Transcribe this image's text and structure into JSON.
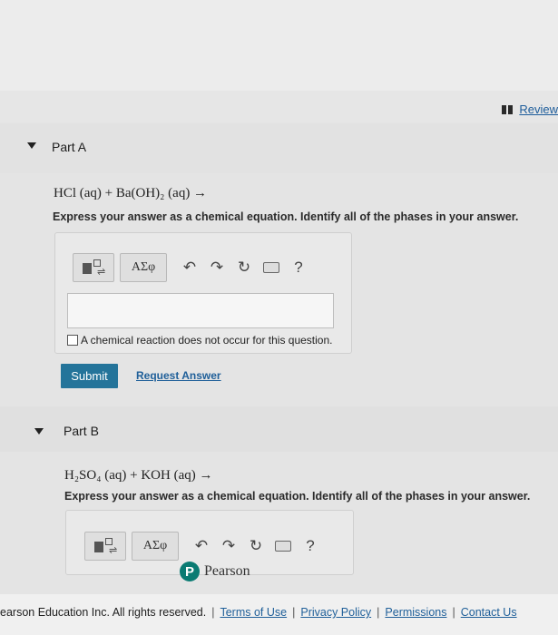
{
  "header": {
    "review_label": "Review"
  },
  "part_a": {
    "title": "Part A",
    "equation": "HCl (aq) + Ba(OH)₂ (aq) →",
    "instruction": "Express your answer as a chemical equation. Identify all of the phases in your answer.",
    "toolbar": {
      "greek_label": "ΑΣφ",
      "help_label": "?"
    },
    "answer_value": "",
    "no_reaction_label": "A chemical reaction does not occur for this question.",
    "submit_label": "Submit",
    "request_label": "Request Answer"
  },
  "part_b": {
    "title": "Part B",
    "equation": "H₂SO₄ (aq) + KOH (aq) →",
    "instruction": "Express your answer as a chemical equation. Identify all of the phases in your answer.",
    "toolbar": {
      "greek_label": "ΑΣφ",
      "help_label": "?"
    }
  },
  "brand": {
    "logo_letter": "P",
    "name": "Pearson"
  },
  "footer": {
    "copyright": "earson Education Inc. All rights reserved.",
    "links": [
      "Terms of Use",
      "Privacy Policy",
      "Permissions",
      "Contact Us"
    ]
  },
  "colors": {
    "submit_bg": "#24749a",
    "link": "#1f5f99",
    "pearson_logo": "#0a7b73"
  }
}
